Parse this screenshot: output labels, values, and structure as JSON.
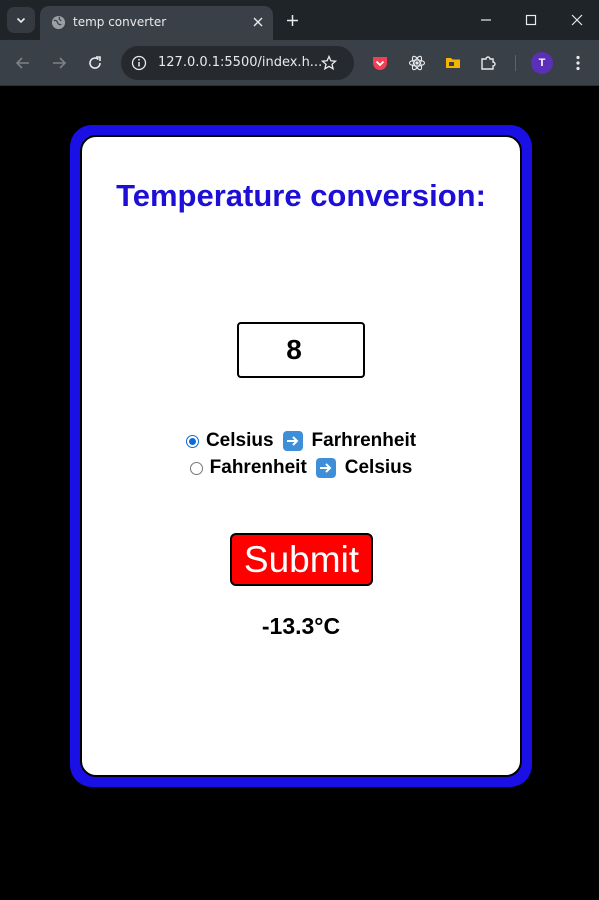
{
  "browser": {
    "tab_title": "temp converter",
    "url": "127.0.0.1:5500/index.h...",
    "profile_initial": "T"
  },
  "page": {
    "heading": "Temperature conversion:",
    "input_value": "8",
    "options": [
      {
        "from": "Celsius",
        "to": "Farhrenheit",
        "checked": true
      },
      {
        "from": "Fahrenheit",
        "to": "Celsius",
        "checked": false
      }
    ],
    "submit_label": "Submit",
    "result": "-13.3°C"
  },
  "colors": {
    "card_border": "#1a10e6",
    "heading": "#1d0fd6",
    "submit_bg": "#ff0000"
  }
}
